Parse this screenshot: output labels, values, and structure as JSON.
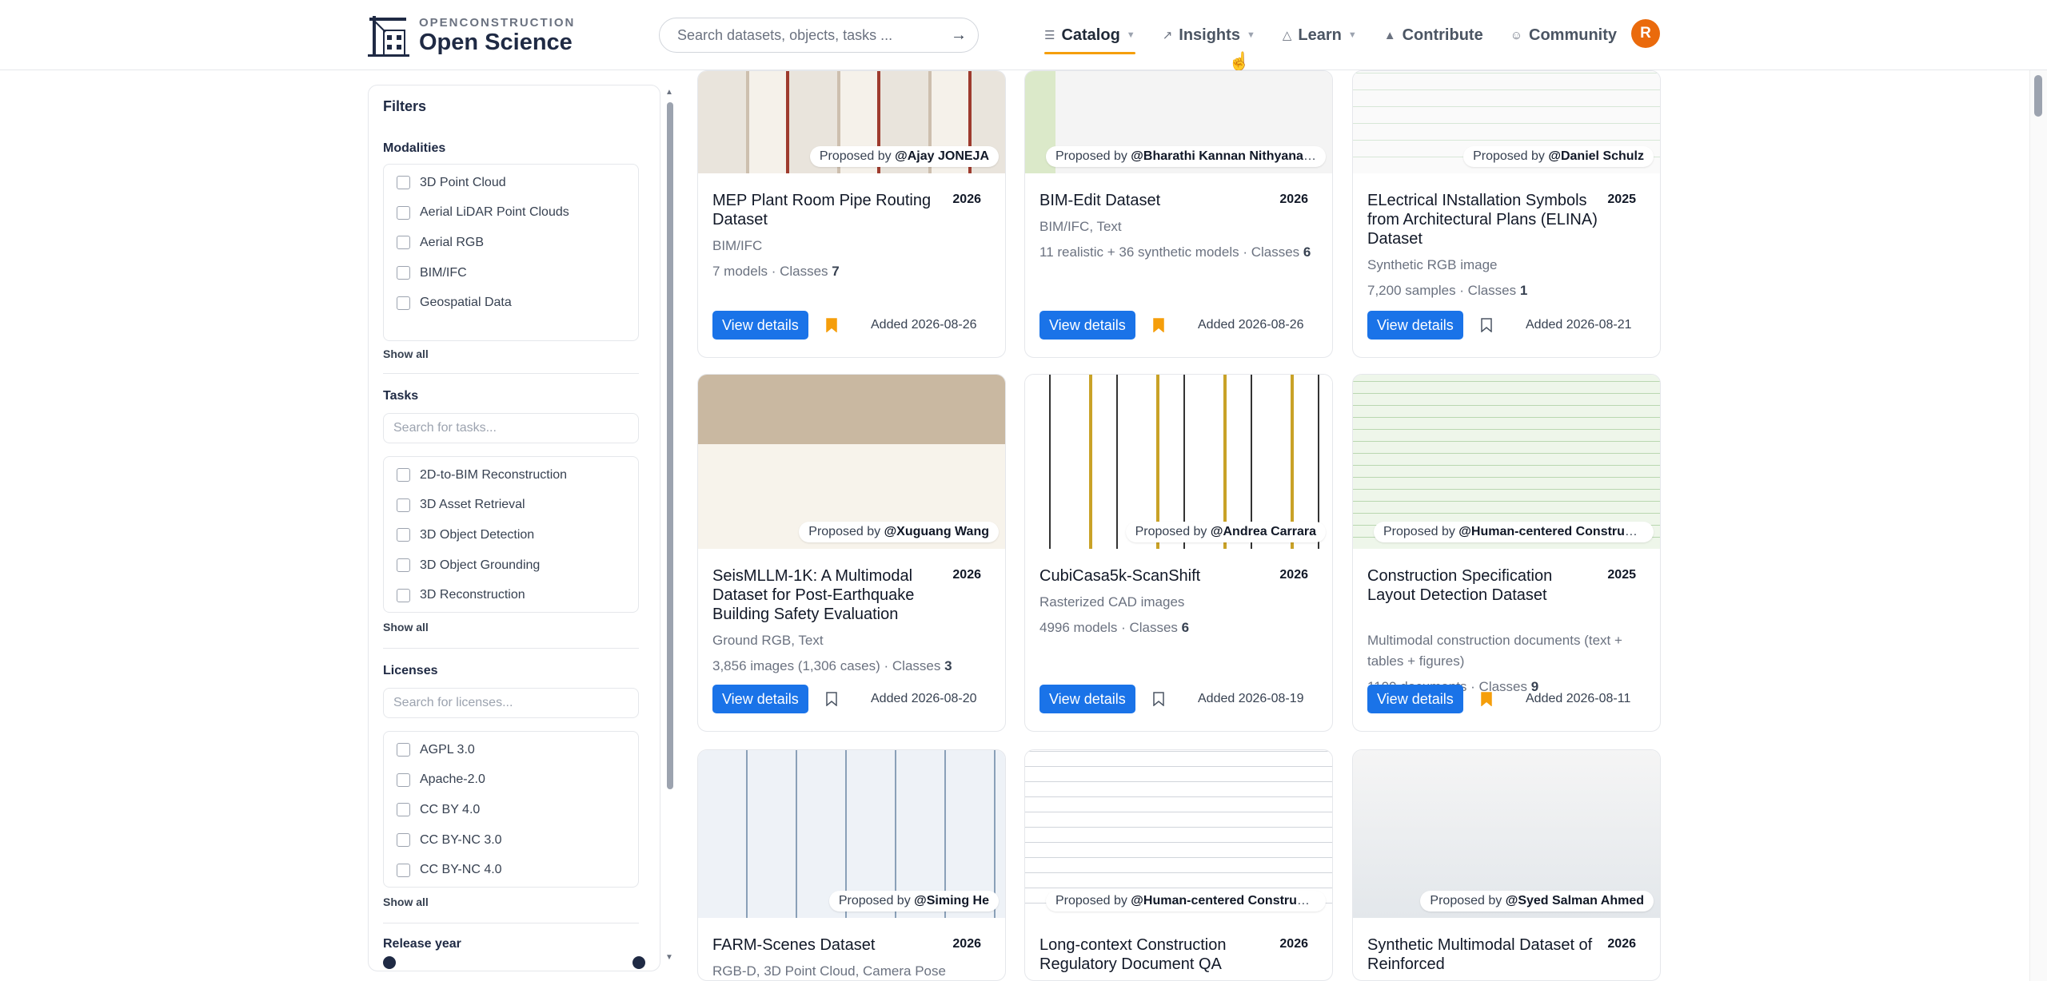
{
  "header": {
    "logo_small": "OPENCONSTRUCTION",
    "logo_big": "Open Science",
    "search_placeholder": "Search datasets, objects, tasks ...",
    "nav": [
      {
        "label": "Catalog"
      },
      {
        "label": "Insights"
      },
      {
        "label": "Learn"
      },
      {
        "label": "Contribute"
      },
      {
        "label": "Community"
      }
    ],
    "avatar_initial": "R"
  },
  "sidebar": {
    "title": "Filters",
    "modalities": {
      "heading": "Modalities",
      "items": [
        "3D Point Cloud",
        "Aerial LiDAR Point Clouds",
        "Aerial RGB",
        "BIM/IFC",
        "Geospatial Data"
      ],
      "show_all": "Show all"
    },
    "tasks": {
      "heading": "Tasks",
      "search_placeholder": "Search for tasks...",
      "items": [
        "2D-to-BIM Reconstruction",
        "3D Asset Retrieval",
        "3D Object Detection",
        "3D Object Grounding",
        "3D Reconstruction"
      ],
      "show_all": "Show all"
    },
    "licenses": {
      "heading": "Licenses",
      "search_placeholder": "Search for licenses...",
      "items": [
        "AGPL 3.0",
        "Apache-2.0",
        "CC BY 4.0",
        "CC BY-NC 3.0",
        "CC BY-NC 4.0"
      ],
      "show_all": "Show all"
    },
    "release_year": {
      "heading": "Release year"
    }
  },
  "cards": [
    {
      "proposed_prefix": "Proposed by",
      "author": "@Ajay JONEJA",
      "title": "MEP Plant Room Pipe Routing Dataset",
      "year": "2026",
      "modality": "BIM/IFC",
      "meta_text": "7 models · Classes",
      "meta_num": "7",
      "button": "View details",
      "bookmarked": true,
      "added": "Added 2026-08-26"
    },
    {
      "proposed_prefix": "Proposed by",
      "author": "@Bharathi Kannan Nithyanan...",
      "title": "BIM-Edit Dataset",
      "year": "2026",
      "modality": "BIM/IFC, Text",
      "meta_text": "11 realistic + 36 synthetic models · Classes",
      "meta_num": "6",
      "button": "View details",
      "bookmarked": true,
      "added": "Added 2026-08-26"
    },
    {
      "proposed_prefix": "Proposed by",
      "author": "@Daniel Schulz",
      "title": "ELectrical INstallation Symbols from Architectural Plans (ELINA) Dataset",
      "year": "2025",
      "modality": "Synthetic RGB image",
      "meta_text": "7,200 samples · Classes",
      "meta_num": "1",
      "button": "View details",
      "bookmarked": false,
      "added": "Added 2026-08-21"
    },
    {
      "proposed_prefix": "Proposed by",
      "author": "@Xuguang Wang",
      "title": "SeisMLLM-1K: A Multimodal Dataset for Post-Earthquake Building Safety Evaluation",
      "year": "2026",
      "modality": "Ground RGB, Text",
      "meta_text": "3,856 images (1,306 cases) · Classes",
      "meta_num": "3",
      "button": "View details",
      "bookmarked": false,
      "added": "Added 2026-08-20"
    },
    {
      "proposed_prefix": "Proposed by",
      "author": "@Andrea Carrara",
      "title": "CubiCasa5k-ScanShift",
      "year": "2026",
      "modality": "Rasterized CAD images",
      "meta_text": "4996 models · Classes",
      "meta_num": "6",
      "button": "View details",
      "bookmarked": false,
      "added": "Added 2026-08-19"
    },
    {
      "proposed_prefix": "Proposed by",
      "author": "@Human-centered Construct...",
      "title": "Construction Specification Layout Detection Dataset",
      "year": "2025",
      "modality": "Multimodal construction documents (text + tables + figures)",
      "meta_text": "1109 documents · Classes",
      "meta_num": "9",
      "button": "View details",
      "bookmarked": true,
      "added": "Added 2026-08-11"
    },
    {
      "proposed_prefix": "Proposed by",
      "author": "@Siming He",
      "title": "FARM-Scenes Dataset",
      "year": "2026",
      "modality": "RGB-D, 3D Point Cloud, Camera Pose",
      "meta_text": "",
      "meta_num": "",
      "button": "",
      "bookmarked": false,
      "added": ""
    },
    {
      "proposed_prefix": "Proposed by",
      "author": "@Human-centered Construct...",
      "title": "Long-context Construction Regulatory Document QA",
      "year": "2026",
      "modality": "",
      "meta_text": "",
      "meta_num": "",
      "button": "",
      "bookmarked": false,
      "added": ""
    },
    {
      "proposed_prefix": "Proposed by",
      "author": "@Syed Salman Ahmed",
      "title": "Synthetic Multimodal Dataset of Reinforced",
      "year": "2026",
      "modality": "",
      "meta_text": "",
      "meta_num": "",
      "button": "",
      "bookmarked": false,
      "added": ""
    }
  ],
  "colors": {
    "primary": "#1a73e8",
    "accent": "#f59e0b",
    "avatar": "#ea6a0c",
    "brand": "#1f2a44"
  }
}
